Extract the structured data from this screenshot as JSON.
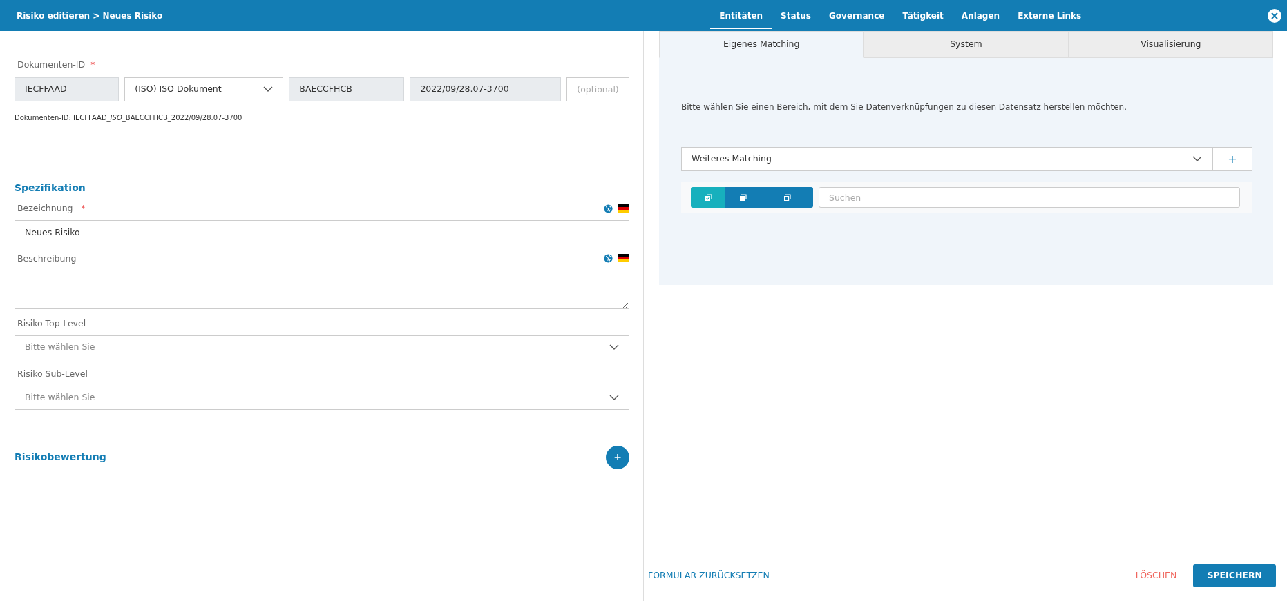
{
  "header": {
    "breadcrumb": "Risiko editieren > Neues Risiko",
    "nav_tabs": [
      {
        "label": "Entitäten",
        "selected": true
      },
      {
        "label": "Status",
        "selected": false
      },
      {
        "label": "Governance",
        "selected": false
      },
      {
        "label": "Tätigkeit",
        "selected": false
      },
      {
        "label": "Anlagen",
        "selected": false
      },
      {
        "label": "Externe Links",
        "selected": false
      }
    ]
  },
  "document_id": {
    "label": "Dokumenten-ID",
    "required_mark": "*",
    "parts": [
      {
        "kind": "readonly",
        "value": "IECFFAAD"
      },
      {
        "kind": "select",
        "value": "(ISO) ISO Dokument"
      },
      {
        "kind": "readonly",
        "value": "BAECCFHCB"
      },
      {
        "kind": "readonly",
        "value": "2022/09/28.07-3700"
      },
      {
        "kind": "input",
        "placeholder": "(optional)"
      }
    ],
    "summary": [
      {
        "text": "Dokumenten-ID: IECFFAAD_",
        "italic": false
      },
      {
        "text": "ISO",
        "italic": true
      },
      {
        "text": "_BAECCFHCB_2022/09/28.07-3700",
        "italic": false
      }
    ]
  },
  "specification": {
    "title": "Spezifikation",
    "fields": [
      {
        "kind": "text",
        "label": "Bezeichnung",
        "required_mark": "*",
        "translatable": true,
        "value": "Neues Risiko"
      },
      {
        "kind": "textarea",
        "label": "Beschreibung",
        "translatable": true
      },
      {
        "kind": "select",
        "label": "Risiko Top-Level",
        "translatable": false,
        "placeholder": "Bitte wählen Sie"
      },
      {
        "kind": "select",
        "label": "Risiko Sub-Level",
        "translatable": false,
        "placeholder": "Bitte wählen Sie"
      }
    ]
  },
  "assessment": {
    "title": "Risikobewertung",
    "add_button": "+"
  },
  "right_panel": {
    "tabs": [
      {
        "label": "Eigenes Matching",
        "selected": true
      },
      {
        "label": "System",
        "selected": false
      },
      {
        "label": "Visualisierung",
        "selected": false
      }
    ],
    "hint": "Bitte wählen Sie einen Bereich, mit dem Sie Datenverknüpfungen zu diesen Datensatz herstellen möchten.",
    "matching_select": "Weiteres Matching",
    "add_button": "+",
    "view_buttons": [
      {
        "selected": true
      },
      {
        "selected": false
      },
      {
        "selected": false
      }
    ],
    "search": {
      "placeholder": "Suchen"
    }
  },
  "footer": {
    "reset": "FORMULAR ZURÜCKSETZEN",
    "delete": "LÖSCHEN",
    "save": "SPEICHERN"
  }
}
